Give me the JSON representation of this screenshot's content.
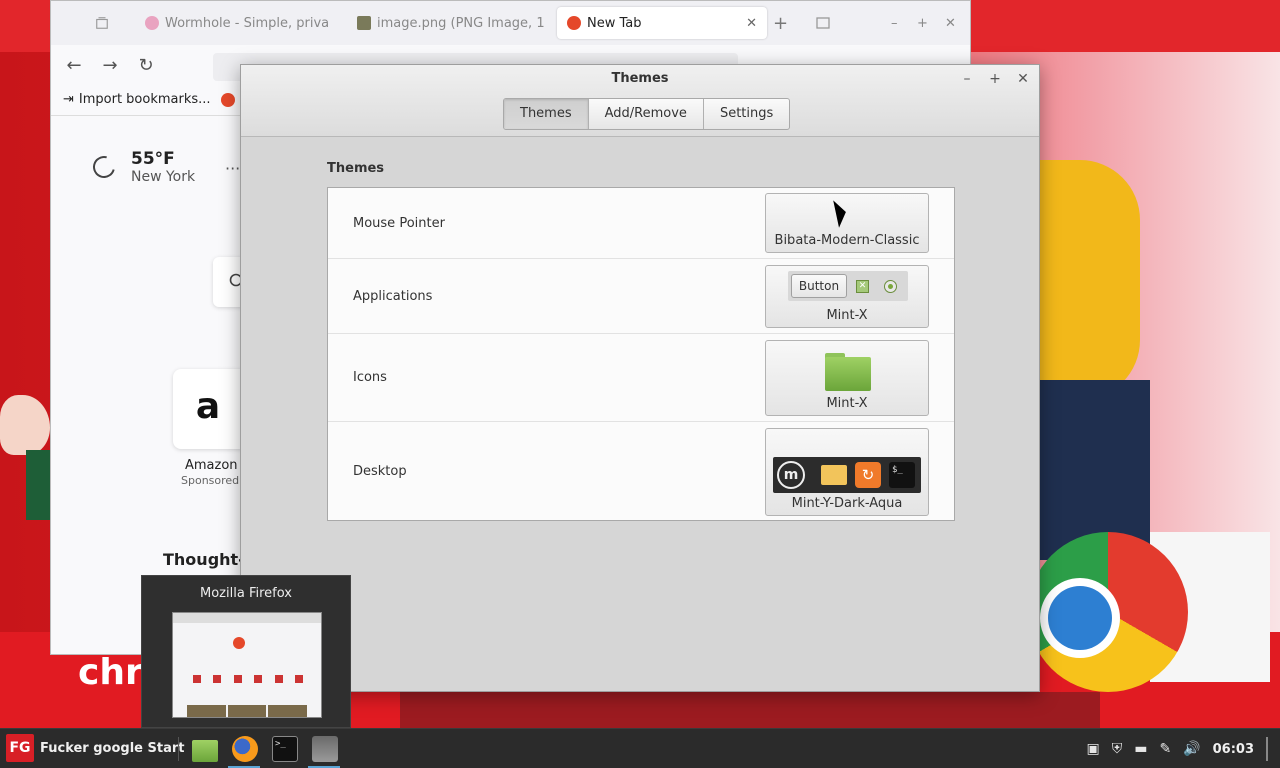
{
  "firefox": {
    "tabs": [
      {
        "label": "Wormhole - Simple, priva"
      },
      {
        "label": "image.png (PNG Image, 1"
      },
      {
        "label": "New Tab"
      }
    ],
    "bookmarks": {
      "import_label": "Import bookmarks..."
    },
    "weather": {
      "temp": "55°F",
      "city": "New York"
    },
    "shortcut": {
      "letter": "a",
      "label": "Amazon",
      "sublabel": "Sponsored"
    },
    "section_heading": "Thought-p"
  },
  "themes_dialog": {
    "title": "Themes",
    "tabs": [
      "Themes",
      "Add/Remove",
      "Settings"
    ],
    "active_tab": "Themes",
    "section_title": "Themes",
    "rows": [
      {
        "label": "Mouse Pointer",
        "value": "Bibata-Modern-Classic"
      },
      {
        "label": "Applications",
        "value": "Mint-X",
        "preview_button": "Button"
      },
      {
        "label": "Icons",
        "value": "Mint-X"
      },
      {
        "label": "Desktop",
        "value": "Mint-Y-Dark-Aqua"
      }
    ]
  },
  "window_preview": {
    "title": "Mozilla Firefox"
  },
  "wallpaper": {
    "text": "chr"
  },
  "taskbar": {
    "start_logo": "FG",
    "start_label": "Fucker google Start",
    "clock": "06:03"
  },
  "colors": {
    "accent": "#5aa5d6",
    "wallpaper_red": "#d51a1a",
    "mint_green": "#7aa63b"
  }
}
